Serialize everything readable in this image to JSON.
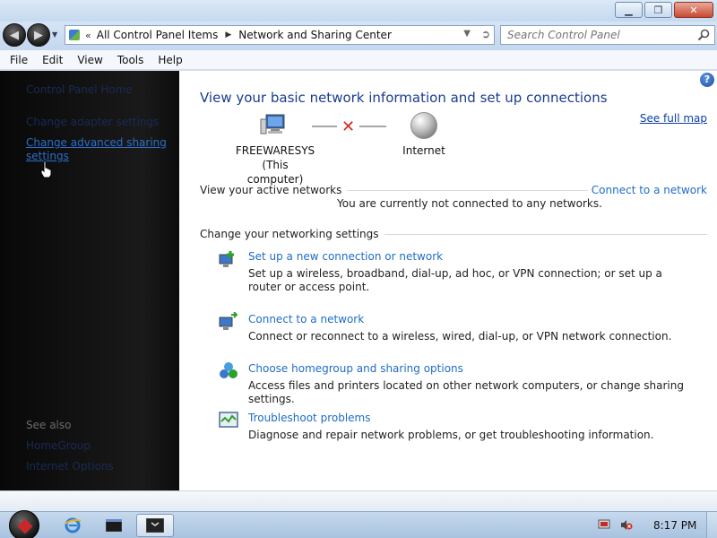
{
  "window": {
    "minimize_icon": "minimize-icon",
    "maximize_icon": "maximize-icon",
    "close_icon": "close-icon"
  },
  "address": {
    "chevron": "«",
    "crumbs": [
      "All Control Panel Items",
      "Network and Sharing Center"
    ],
    "separator": "▶"
  },
  "search": {
    "placeholder": "Search Control Panel"
  },
  "menu": [
    "File",
    "Edit",
    "View",
    "Tools",
    "Help"
  ],
  "sidebar": {
    "links": [
      "Control Panel Home",
      "Change adapter settings",
      "Change advanced sharing settings"
    ],
    "see_also_heading": "See also",
    "see_also": [
      "HomeGroup",
      "Internet Options"
    ]
  },
  "main": {
    "title": "View your basic network information and set up connections",
    "see_full_map": "See full map",
    "computer_name": "FREEWARESYS",
    "computer_sub": "(This computer)",
    "internet_label": "Internet",
    "active_networks_heading": "View your active networks",
    "connect_link": "Connect to a network",
    "not_connected": "You are currently not connected to any networks.",
    "settings_heading": "Change your networking settings",
    "tasks": [
      {
        "link": "Set up a new connection or network",
        "desc": "Set up a wireless, broadband, dial-up, ad hoc, or VPN connection; or set up a router or access point."
      },
      {
        "link": "Connect to a network",
        "desc": "Connect or reconnect to a wireless, wired, dial-up, or VPN network connection."
      },
      {
        "link": "Choose homegroup and sharing options",
        "desc": "Access files and printers located on other network computers, or change sharing settings."
      },
      {
        "link": "Troubleshoot problems",
        "desc": "Diagnose and repair network problems, or get troubleshooting information."
      }
    ]
  },
  "taskbar": {
    "clock": "8:17 PM"
  },
  "colors": {
    "link": "#1f6cc8",
    "title": "#1a3d8f",
    "error_x": "#d42a1e"
  }
}
